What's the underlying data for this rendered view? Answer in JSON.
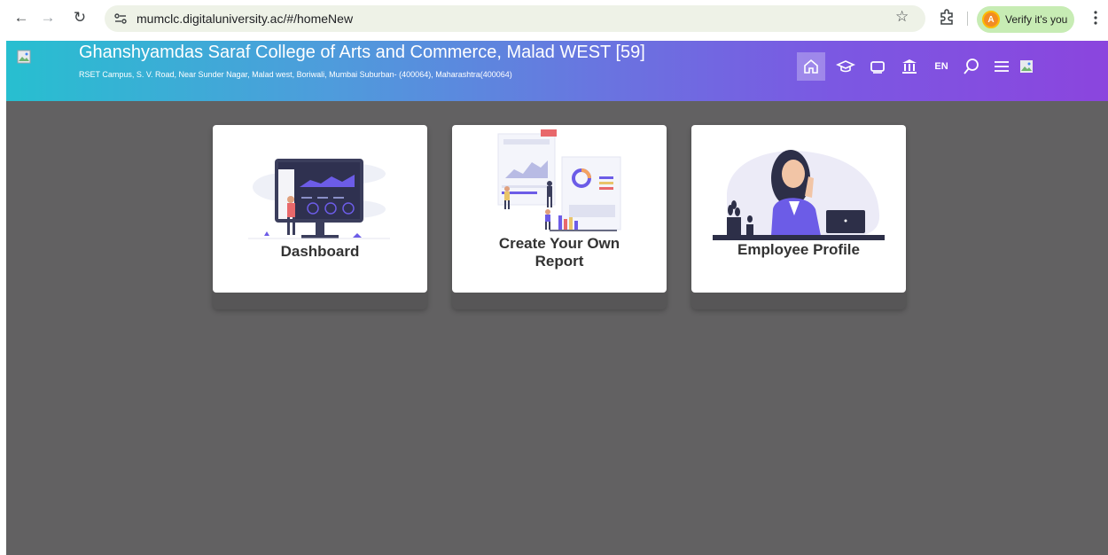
{
  "browser": {
    "url": "mumclc.digitaluniversity.ac/#/homeNew",
    "verify_label": "Verify it's you",
    "avatar_letter": "A"
  },
  "header": {
    "college_name": "Ghanshyamdas Saraf College of Arts and Commerce, Malad WEST [59]",
    "address": "RSET Campus, S. V. Road, Near Sunder Nagar, Malad west, Boriwali, Mumbai Suburban- (400064), Maharashtra(400064)",
    "language": "EN",
    "icons": [
      "home-icon",
      "graduation-cap-icon",
      "window-icon",
      "institution-icon",
      "language-icon",
      "search-icon",
      "menu-icon",
      "profile-image-icon"
    ],
    "brand_colors": [
      "#27bfd0",
      "#8b45de"
    ]
  },
  "cards": [
    {
      "title": "Dashboard",
      "illustration": "dashboard-illustration"
    },
    {
      "title": "Create Your Own Report",
      "title_line1": "Create Your Own",
      "title_line2": "Report",
      "illustration": "report-illustration"
    },
    {
      "title": "Employee Profile",
      "illustration": "employee-illustration"
    }
  ],
  "colors": {
    "main_background": "#626162",
    "card_background": "#ffffff",
    "accent_purple": "#6c5ce7"
  }
}
